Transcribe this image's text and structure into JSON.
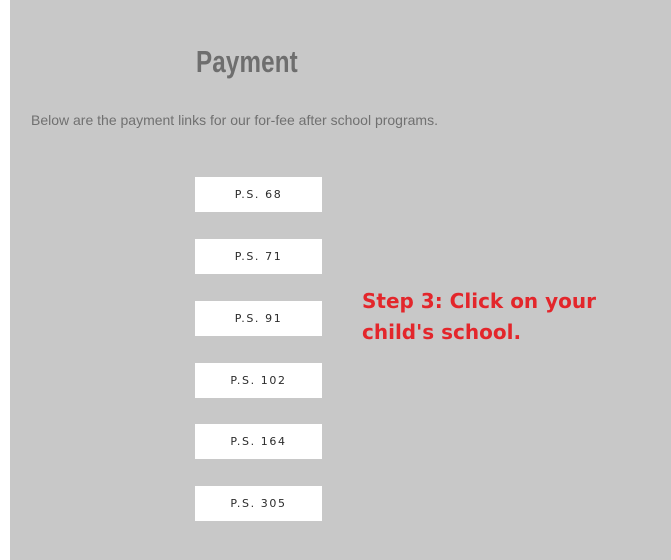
{
  "page": {
    "title": "Payment",
    "intro": "Below are the payment links for our for-fee after school programs."
  },
  "schools": [
    {
      "label": "P.S. 68"
    },
    {
      "label": "P.S. 71"
    },
    {
      "label": "P.S. 91"
    },
    {
      "label": "P.S. 102"
    },
    {
      "label": "P.S. 164"
    },
    {
      "label": "P.S. 305"
    }
  ],
  "annotation": {
    "line1": "Step 3: Click on your",
    "line2": "child's school."
  },
  "colors": {
    "panel_background": "#c8c8c8",
    "button_background": "#ffffff",
    "title_text": "#6e6e6e",
    "annotation_text": "#e3262b"
  }
}
